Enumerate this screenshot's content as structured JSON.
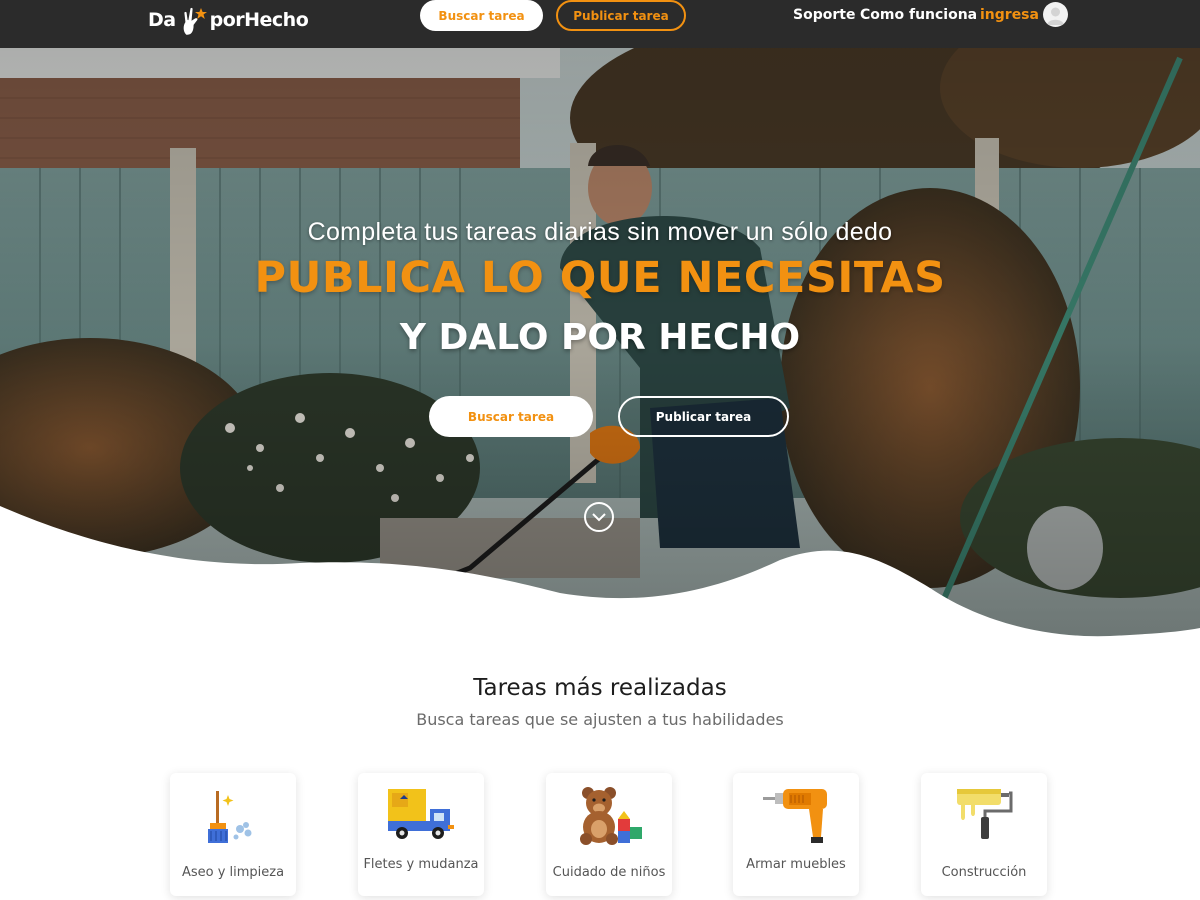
{
  "nav": {
    "logo_left": "Da",
    "logo_right": "porHecho",
    "buscar_label": "Buscar tarea",
    "publicar_label": "Publicar tarea",
    "soporte_label": "Soporte",
    "como_label": "Como funciona",
    "ingresa_label": "ingresa"
  },
  "hero": {
    "title": "Completa tus tareas diarias sin mover un sólo dedo",
    "headline": "PUBLICA LO QUE NECESITAS",
    "subheadline": "Y DALO POR HECHO",
    "buscar_label": "Buscar tarea",
    "publicar_label": "Publicar tarea"
  },
  "section": {
    "title": "Tareas más realizadas",
    "subtitle": "Busca tareas que se ajusten a tus habilidades"
  },
  "categories": [
    {
      "label": "Aseo y limpieza",
      "icon": "broom-icon"
    },
    {
      "label": "Fletes y mudanza",
      "icon": "truck-icon"
    },
    {
      "label": "Cuidado de niños",
      "icon": "teddy-bear-icon"
    },
    {
      "label": "Armar muebles",
      "icon": "drill-icon"
    },
    {
      "label": "Construcción",
      "icon": "paint-roller-icon"
    }
  ],
  "colors": {
    "accent": "#f29111",
    "navbar": "#2b2b2b"
  }
}
